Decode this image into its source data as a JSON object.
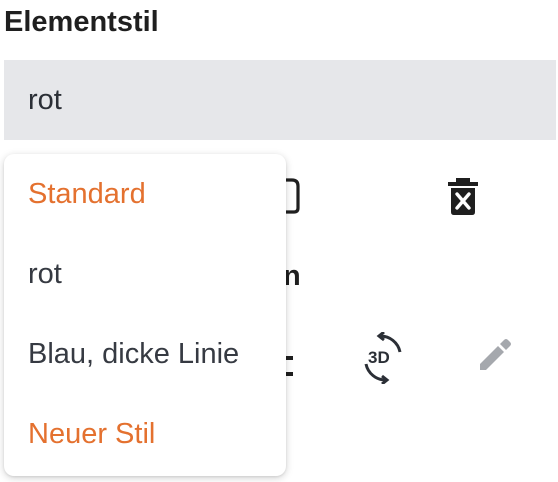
{
  "section_title": "Elementstil",
  "style_select": {
    "value": "rot"
  },
  "dropdown": {
    "items": [
      {
        "label": "Standard",
        "color": "#e4712f"
      },
      {
        "label": "rot",
        "color": "#363a42"
      },
      {
        "label": "Blau, dicke Linie",
        "color": "#363a42"
      },
      {
        "label": "Neuer Stil",
        "color": "#e4712f"
      }
    ]
  },
  "toolbar": {
    "rotate_3d_label": "3D"
  },
  "partial_heading_fragment": "n",
  "icons": [
    "copy-icon",
    "trash-icon",
    "rotate-3d-icon",
    "pencil-icon"
  ],
  "colors": {
    "accent": "#e4712f",
    "select_background": "#e6e7ea",
    "text": "#363a42"
  }
}
